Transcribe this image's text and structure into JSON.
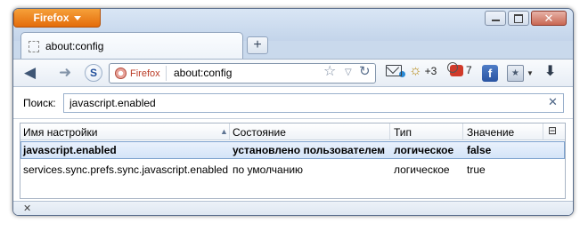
{
  "window": {
    "menu_button": "Firefox",
    "controls": {
      "minimize": "minimize-icon",
      "maximize": "maximize-icon",
      "close": "close-icon"
    }
  },
  "tabs": [
    {
      "title": "about:config",
      "favicon": "blank-page-icon"
    }
  ],
  "new_tab_icon": "+",
  "navbar": {
    "identity_label": "Firefox",
    "url": "about:config",
    "counters": {
      "weather": "+3",
      "comments": "7"
    },
    "false_icon_label": "f"
  },
  "search": {
    "label": "Поиск:",
    "value": "javascript.enabled"
  },
  "table": {
    "columns": [
      "Имя настройки",
      "Состояние",
      "Тип",
      "Значение"
    ],
    "rows": [
      {
        "name": "javascript.enabled",
        "status": "установлено пользователем",
        "type": "логическое",
        "value": "false",
        "selected": true
      },
      {
        "name": "services.sync.prefs.sync.javascript.enabled",
        "status": "по умолчанию",
        "type": "логическое",
        "value": "true",
        "selected": false
      }
    ]
  },
  "colors": {
    "accent_orange": "#e46c0b",
    "selection": "#d4e4f8",
    "frame": "#c9d9ec"
  }
}
